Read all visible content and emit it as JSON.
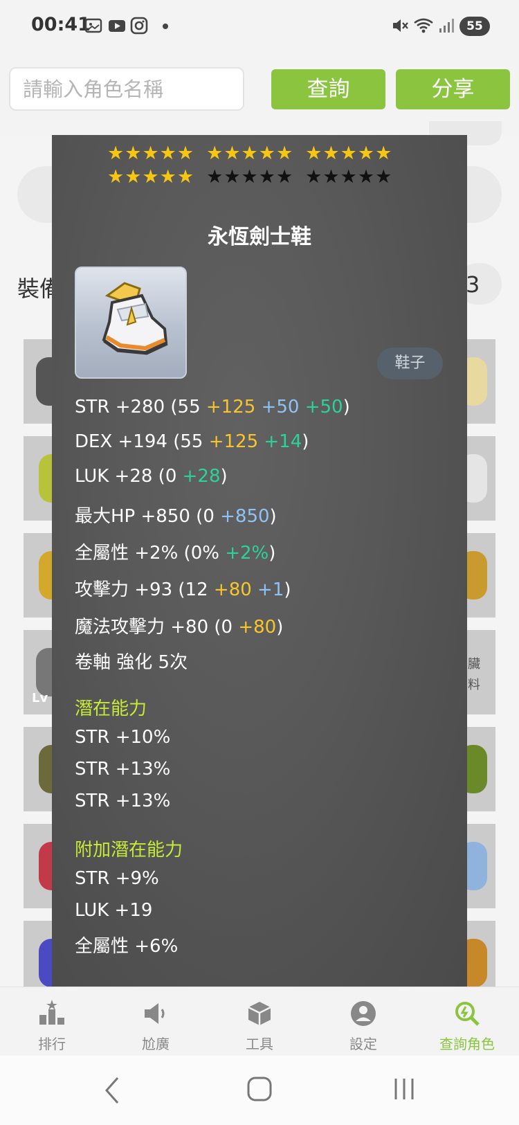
{
  "status_bar": {
    "time": "00:41",
    "battery": "55",
    "icons": [
      "gallery-icon",
      "youtube-icon",
      "instagram-icon",
      "dot-icon",
      "mute-icon",
      "wifi-icon",
      "signal-icon"
    ]
  },
  "search": {
    "placeholder": "請輸入角色名稱",
    "query_button": "查詢",
    "share_button": "分享"
  },
  "background": {
    "heading": "裝備",
    "count_suffix": "3",
    "slot_texts": [
      "Lv",
      "臟",
      "料"
    ]
  },
  "tooltip": {
    "stars": {
      "filled": 20,
      "total": 30,
      "colors": {
        "filled": "#f7c615",
        "empty": "#111111"
      }
    },
    "item_name": "永恆劍士鞋",
    "item_type": "鞋子",
    "stats": [
      {
        "base": "STR +280 (55 ",
        "parts": [
          {
            "text": "+125",
            "color": "yellow"
          },
          {
            "text": " +50",
            "color": "blue"
          },
          {
            "text": " +50",
            "color": "green"
          }
        ],
        "end": ")"
      },
      {
        "base": "DEX +194 (55 ",
        "parts": [
          {
            "text": "+125",
            "color": "yellow"
          },
          {
            "text": " +14",
            "color": "green"
          }
        ],
        "end": ")"
      },
      {
        "base": "LUK +28 (0 ",
        "parts": [
          {
            "text": "+28",
            "color": "green"
          }
        ],
        "end": ")"
      },
      {
        "base": "最大HP +850 (0 ",
        "parts": [
          {
            "text": "+850",
            "color": "blue"
          }
        ],
        "end": ")"
      },
      {
        "base": "全屬性 +2% (0% ",
        "parts": [
          {
            "text": "+2%",
            "color": "green"
          }
        ],
        "end": ")"
      },
      {
        "base": "攻擊力 +93  (12 ",
        "parts": [
          {
            "text": "+80",
            "color": "yellow"
          },
          {
            "text": " +1",
            "color": "blue"
          }
        ],
        "end": ")"
      },
      {
        "base": "魔法攻擊力 +80  (0 ",
        "parts": [
          {
            "text": "+80",
            "color": "yellow"
          }
        ],
        "end": ")"
      },
      {
        "base": "卷軸 強化 5次",
        "parts": [],
        "end": ""
      }
    ],
    "potential_title": "潛在能力",
    "potential": [
      "STR +10%",
      "STR +13%",
      "STR +13%"
    ],
    "additional_title": "附加潛在能力",
    "additional": [
      "STR +9%",
      "LUK +19",
      "全屬性 +6%"
    ]
  },
  "bottom_nav": [
    {
      "label": "排行",
      "icon": "ranking-icon",
      "active": false
    },
    {
      "label": "尬廣",
      "icon": "megaphone-icon",
      "active": false
    },
    {
      "label": "工具",
      "icon": "box-icon",
      "active": false
    },
    {
      "label": "設定",
      "icon": "user-icon",
      "active": false
    },
    {
      "label": "查詢角色",
      "icon": "search-character-icon",
      "active": true
    }
  ],
  "colors": {
    "accent": "#8bc540",
    "stat_yellow": "#f8c62b",
    "stat_blue": "#8ec3f5",
    "stat_green": "#2bd39a",
    "section_title": "#c5ea37"
  }
}
